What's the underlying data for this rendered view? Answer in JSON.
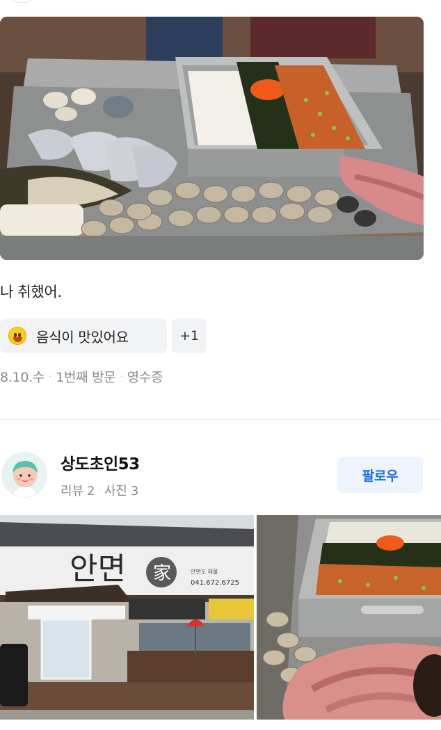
{
  "review": {
    "text": "나 취했어.",
    "tag": {
      "icon": "smiling-face-icon",
      "label": "음식이 맛있어요"
    },
    "more_tags": "+1",
    "meta": {
      "date": "8.10.수",
      "visit": "1번째 방문",
      "proof": "영수증"
    }
  },
  "reviewer": {
    "name": "상도초인53",
    "reviews": "리뷰 2",
    "photos": "사진 3",
    "follow_label": "팔로우"
  },
  "store_sign": {
    "name": "안면",
    "hanja": "家",
    "small_text": "안면도 해물",
    "phone": "041.672.6725"
  },
  "colors": {
    "accent": "#1e6fe0",
    "chip_bg": "#f2f3f5",
    "follow_bg": "#eef4fd"
  }
}
